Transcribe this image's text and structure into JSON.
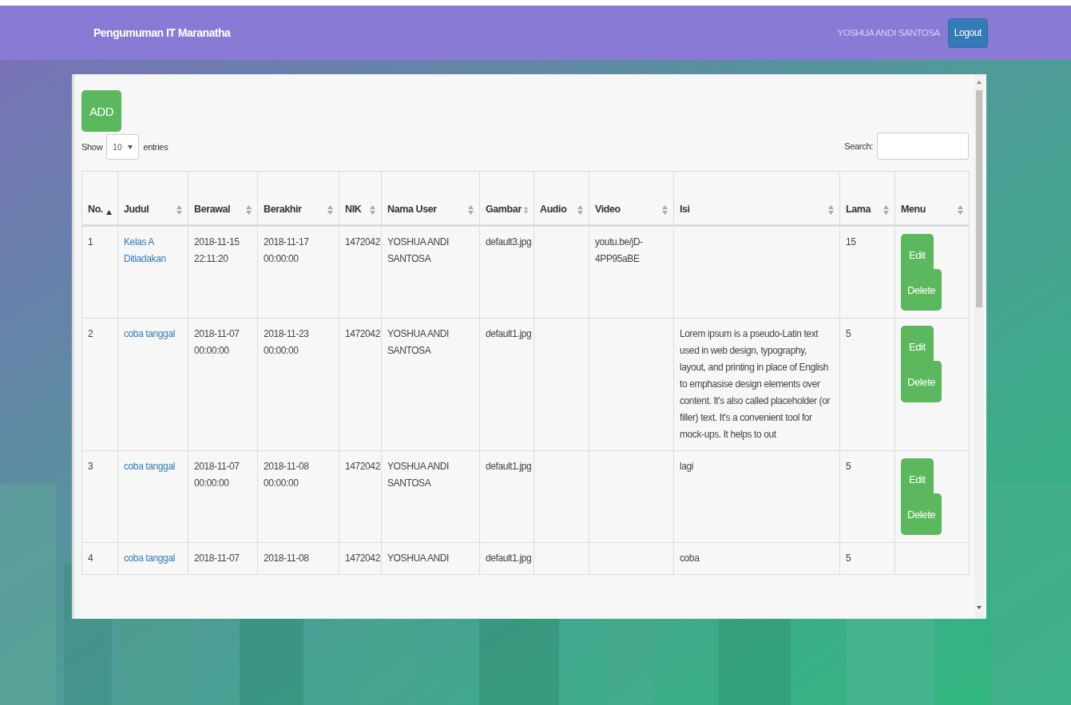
{
  "navbar": {
    "brand": "Pengumuman IT Maranatha",
    "user": "YOSHUA ANDI SANTOSA",
    "logout": "Logout"
  },
  "add_button": "ADD",
  "length": {
    "show": "Show",
    "value": "10",
    "entries": "entries"
  },
  "search": {
    "label": "Search:"
  },
  "columns": [
    {
      "label": "No.",
      "sorted": true
    },
    {
      "label": "Judul",
      "sorted": false
    },
    {
      "label": "Berawal",
      "sorted": false
    },
    {
      "label": "Berakhir",
      "sorted": false
    },
    {
      "label": "NIK",
      "sorted": false
    },
    {
      "label": "Nama User",
      "sorted": false
    },
    {
      "label": "Gambar",
      "sorted": false
    },
    {
      "label": "Audio",
      "sorted": false
    },
    {
      "label": "Video",
      "sorted": false
    },
    {
      "label": "Isi",
      "sorted": false
    },
    {
      "label": "Lama",
      "sorted": false
    },
    {
      "label": "Menu",
      "sorted": false
    }
  ],
  "rows": [
    {
      "no": "1",
      "judul": "Kelas A Ditiadakan",
      "berawal": "2018-11-15 22:11:20",
      "berakhir": "2018-11-17 00:00:00",
      "nik": "1472042",
      "nama": "YOSHUA ANDI SANTOSA",
      "gambar": "default3.jpg",
      "video": "youtu.be/jD-4PP95aBE",
      "lama": "15",
      "menu": [
        "Edit",
        "Delete"
      ]
    },
    {
      "no": "2",
      "judul": "coba tanggal",
      "berawal": "2018-11-07 00:00:00",
      "berakhir": "2018-11-23 00:00:00",
      "nik": "1472042",
      "nama": "YOSHUA ANDI SANTOSA",
      "gambar": "default1.jpg",
      "isi": "Lorem ipsum is a pseudo-Latin text used in web design, typography, layout, and printing in place of English to emphasise design elements over content. It's also called placeholder (or filler) text. It's a convenient tool for mock-ups. It helps to out",
      "lama": "5",
      "menu": [
        "Edit",
        "Delete"
      ]
    },
    {
      "no": "3",
      "judul": "coba tanggal",
      "berawal": "2018-11-07 00:00:00",
      "berakhir": "2018-11-08 00:00:00",
      "nik": "1472042",
      "nama": "YOSHUA ANDI SANTOSA",
      "gambar": "default1.jpg",
      "isi": "lagi",
      "lama": "5",
      "menu": [
        "Edit",
        "Delete"
      ]
    },
    {
      "no": "4",
      "judul": "coba tanggal",
      "berawal": "2018-11-07",
      "berakhir": "2018-11-08",
      "nik": "1472042",
      "nama": "YOSHUA ANDI",
      "gambar": "default1.jpg",
      "isi": "coba",
      "lama": "5"
    }
  ]
}
